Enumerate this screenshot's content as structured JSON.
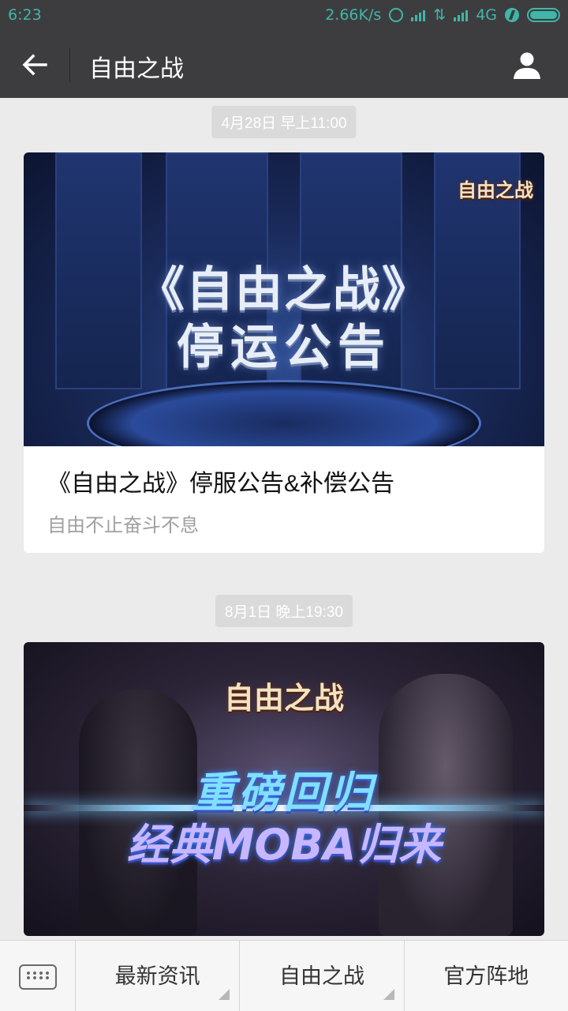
{
  "status_bar": {
    "time": "6:23",
    "network_speed": "2.66K/s",
    "network_type": "4G",
    "icons": [
      "alarm-icon",
      "signal-icon",
      "data-transfer-icon",
      "signal-icon",
      "charging-icon",
      "battery-icon"
    ],
    "accent_color": "#3fb6a8"
  },
  "nav": {
    "title": "自由之战",
    "back_icon": "arrow-left-icon",
    "profile_icon": "person-icon",
    "background": "#3d3d3f"
  },
  "messages": [
    {
      "timestamp": "4月28日 早上11:00",
      "cover_logo": "自由之战",
      "cover_line1": "《自由之战》",
      "cover_line2": "停运公告",
      "headline": "《自由之战》停服公告&补偿公告",
      "digest": "自由不止奋斗不息"
    },
    {
      "timestamp": "8月1日 晚上19:30",
      "cover_logo": "自由之战",
      "cover_line1": "重磅回归",
      "cover_line2": "经典MOBA归来"
    }
  ],
  "bottom_menu": {
    "keyboard_icon": "keyboard-icon",
    "items": [
      "最新资讯",
      "自由之战",
      "官方阵地"
    ]
  }
}
